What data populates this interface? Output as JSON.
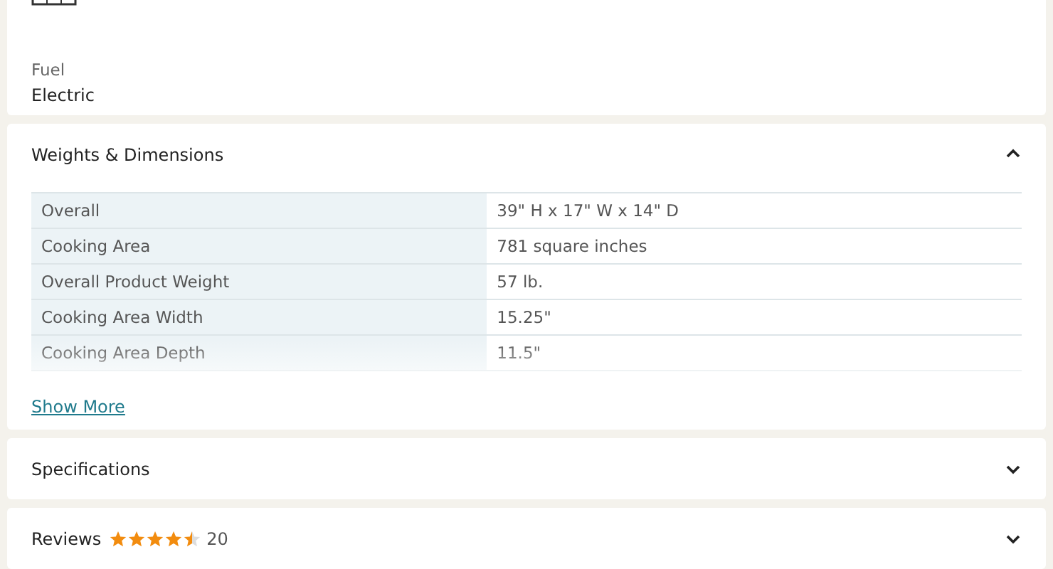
{
  "fuel": {
    "label": "Fuel",
    "value": "Electric"
  },
  "sections": [
    {
      "title": "Weights & Dimensions",
      "expanded": true,
      "rows": [
        {
          "name": "Overall",
          "value": "39\" H x 17\" W x 14\" D"
        },
        {
          "name": "Cooking Area",
          "value": "781 square inches"
        },
        {
          "name": "Overall Product Weight",
          "value": "57 lb."
        },
        {
          "name": "Cooking Area Width",
          "value": "15.25\""
        },
        {
          "name": "Cooking Area Depth",
          "value": "11.5\""
        }
      ],
      "link": "Show More"
    },
    {
      "title": "Specifications",
      "expanded": false
    },
    {
      "title": "Reviews",
      "expanded": false,
      "stars": 4.5,
      "count": "20"
    }
  ]
}
